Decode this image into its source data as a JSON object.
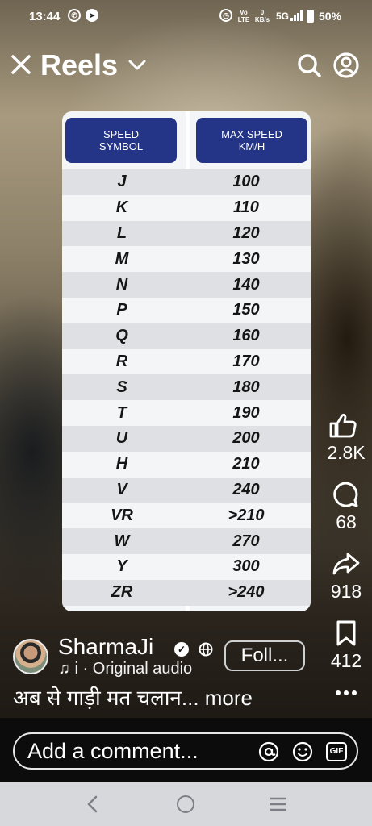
{
  "status_bar": {
    "time": "13:44",
    "network_small": "Vo LTE",
    "speed_small": "0 KB/s",
    "signal": "5G",
    "battery": "50%"
  },
  "header": {
    "title": "Reels"
  },
  "speed_table": {
    "col1_header": "SPEED SYMBOL",
    "col2_header": "MAX SPEED KM/H",
    "rows": [
      {
        "symbol": "J",
        "speed": "100"
      },
      {
        "symbol": "K",
        "speed": "110"
      },
      {
        "symbol": "L",
        "speed": "120"
      },
      {
        "symbol": "M",
        "speed": "130"
      },
      {
        "symbol": "N",
        "speed": "140"
      },
      {
        "symbol": "P",
        "speed": "150"
      },
      {
        "symbol": "Q",
        "speed": "160"
      },
      {
        "symbol": "R",
        "speed": "170"
      },
      {
        "symbol": "S",
        "speed": "180"
      },
      {
        "symbol": "T",
        "speed": "190"
      },
      {
        "symbol": "U",
        "speed": "200"
      },
      {
        "symbol": "H",
        "speed": "210"
      },
      {
        "symbol": "V",
        "speed": "240"
      },
      {
        "symbol": "VR",
        "speed": ">210"
      },
      {
        "symbol": "W",
        "speed": "270"
      },
      {
        "symbol": "Y",
        "speed": "300"
      },
      {
        "symbol": "ZR",
        "speed": ">240"
      }
    ]
  },
  "actions": {
    "likes": "2.8K",
    "comments": "68",
    "shares": "918",
    "saves": "412"
  },
  "author": {
    "name": "SharmaJi",
    "audio": "♫ i · Original audio",
    "follow_label": "Foll..."
  },
  "caption": "अब से गाड़ी मत चलान... more",
  "comment_bar": {
    "placeholder": "Add a comment...",
    "gif_label": "GIF"
  },
  "colors": {
    "table_header": "#243587",
    "nav_bar": "#d7d8dc"
  }
}
